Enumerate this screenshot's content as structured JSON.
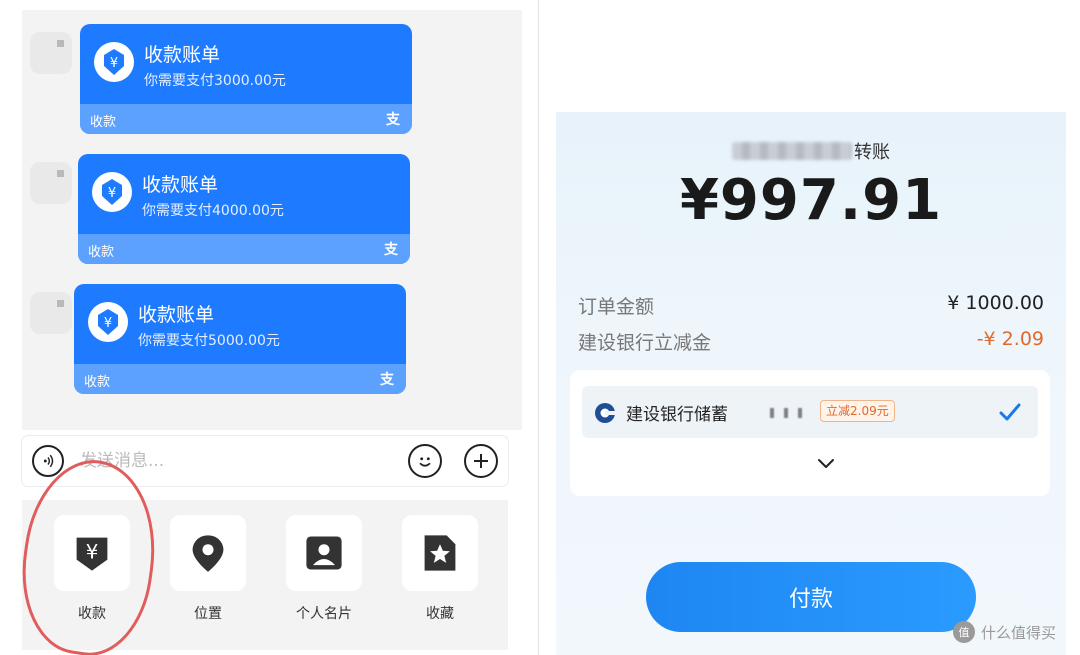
{
  "chat": {
    "bills": [
      {
        "title": "收款账单",
        "subtitle": "你需要支付3000.00元",
        "footer": "收款",
        "brand": "支"
      },
      {
        "title": "收款账单",
        "subtitle": "你需要支付4000.00元",
        "footer": "收款",
        "brand": "支"
      },
      {
        "title": "收款账单",
        "subtitle": "你需要支付5000.00元",
        "footer": "收款",
        "brand": "支"
      }
    ]
  },
  "input": {
    "placeholder": "发送消息..."
  },
  "tools": [
    {
      "label": "收款",
      "icon": "yuan-icon"
    },
    {
      "label": "位置",
      "icon": "location-pin-icon"
    },
    {
      "label": "个人名片",
      "icon": "contact-card-icon"
    },
    {
      "label": "收藏",
      "icon": "favorite-star-icon"
    }
  ],
  "payment": {
    "payee_suffix": "转账",
    "amount": "¥997.91",
    "order_label": "订单金额",
    "order_value": "¥ 1000.00",
    "discount_label": "建设银行立减金",
    "discount_value": "-¥ 2.09",
    "bank_name": "建设银行储蓄",
    "promo": "立减2.09元",
    "pay_button": "付款"
  },
  "watermark": {
    "text": "什么值得买",
    "icon_char": "值"
  },
  "colors": {
    "bill_blue": "#1e7bff",
    "discount_orange": "#e06a2b",
    "pay_blue": "#1e86f2",
    "annotation_red": "#e15c5c"
  }
}
